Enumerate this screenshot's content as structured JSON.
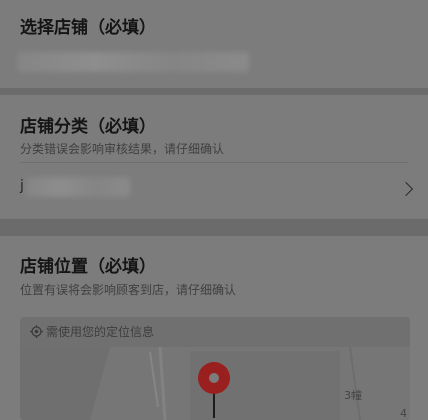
{
  "store": {
    "title": "选择店铺（必填）"
  },
  "category": {
    "title": "店铺分类（必填）",
    "hint": "分类错误会影响审核结果，请仔细确认",
    "value": "j"
  },
  "location": {
    "title": "店铺位置（必填）",
    "hint": "位置有误将会影响顾客到店，请仔细确认",
    "tip": "需使用您的定位信息",
    "map_labels": [
      "3幢",
      "4"
    ]
  }
}
